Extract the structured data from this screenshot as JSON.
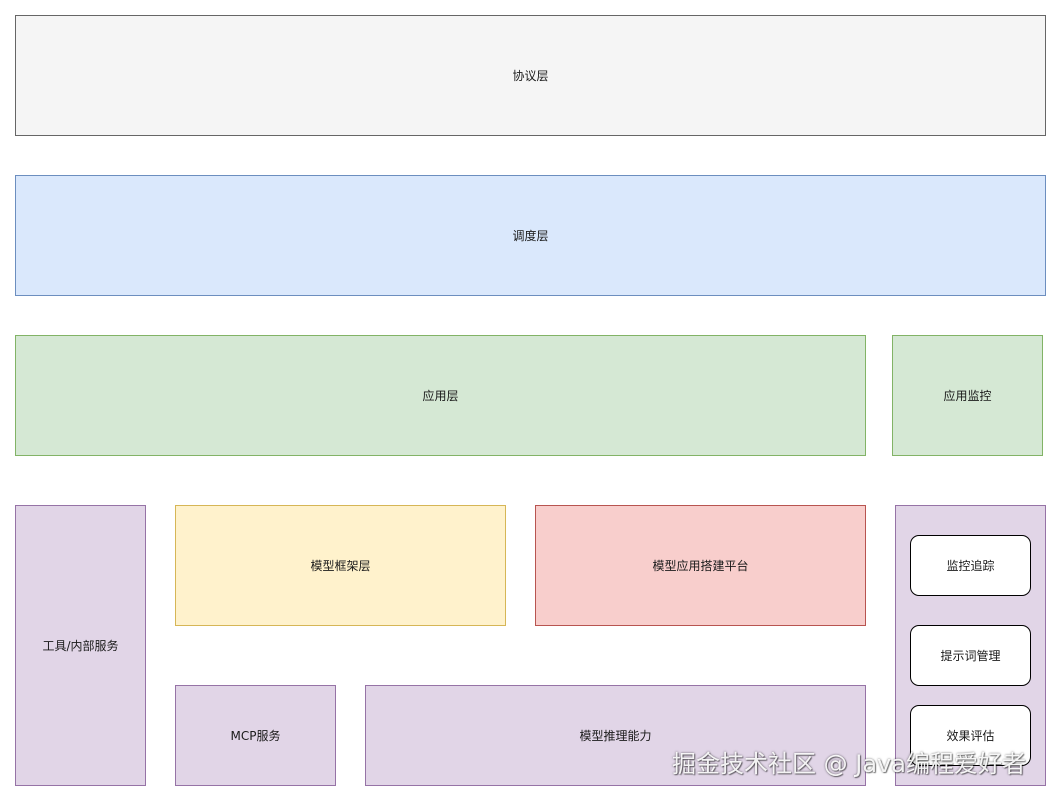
{
  "diagram": {
    "protocol_layer": "协议层",
    "scheduling_layer": "调度层",
    "application_layer": "应用层",
    "application_monitoring": "应用监控",
    "tools_internal_services": "工具/内部服务",
    "model_framework_layer": "模型框架层",
    "model_app_platform": "模型应用搭建平台",
    "mcp_service": "MCP服务",
    "model_inference": "模型推理能力",
    "right_panel": {
      "items": [
        "监控追踪",
        "提示词管理",
        "效果评估"
      ]
    }
  },
  "watermark": "掘金技术社区 @ Java编程爱好者",
  "colors": {
    "gray_fill": "#f5f5f5",
    "blue_fill": "#dae8fc",
    "green_fill": "#d5e8d4",
    "purple_fill": "#e1d5e7",
    "yellow_fill": "#fff2cc",
    "red_fill": "#f8cecc"
  }
}
